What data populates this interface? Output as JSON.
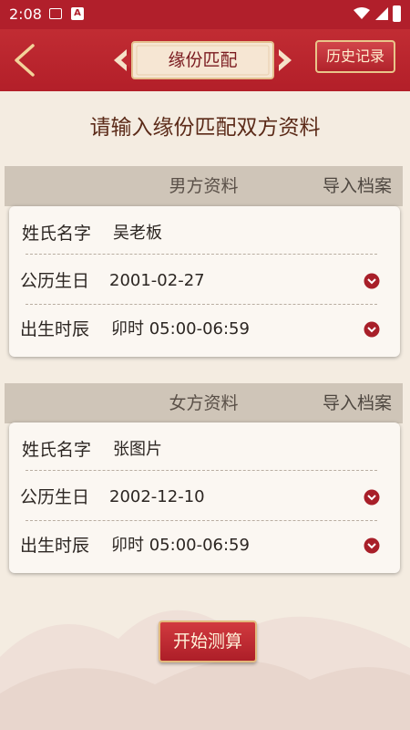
{
  "status_bar": {
    "time": "2:08"
  },
  "header": {
    "title": "缘份匹配",
    "history_label": "历史记录"
  },
  "heading": "请输入缘份匹配双方资料",
  "male": {
    "section_title": "男方资料",
    "import_label": "导入档案",
    "rows": [
      {
        "label": "姓氏名字",
        "value": "吴老板"
      },
      {
        "label": "公历生日",
        "value": "2001-02-27"
      },
      {
        "label": "出生时辰",
        "value": "卯时 05:00-06:59"
      }
    ]
  },
  "female": {
    "section_title": "女方资料",
    "import_label": "导入档案",
    "rows": [
      {
        "label": "姓氏名字",
        "value": "张图片"
      },
      {
        "label": "公历生日",
        "value": "2002-12-10"
      },
      {
        "label": "出生时辰",
        "value": "卯时 05:00-06:59"
      }
    ]
  },
  "start_label": "开始测算",
  "colors": {
    "primary_red": "#b11f2b",
    "gold": "#e3b97c",
    "background": "#f4ece1"
  }
}
